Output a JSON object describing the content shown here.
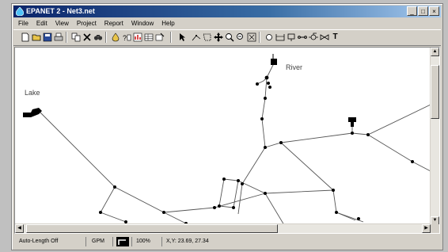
{
  "window": {
    "title": "EPANET 2 - Net3.net",
    "controls": {
      "minimize": "_",
      "maximize": "□",
      "close": "×"
    }
  },
  "menu": [
    "File",
    "Edit",
    "View",
    "Project",
    "Report",
    "Window",
    "Help"
  ],
  "toolbar": {
    "icons": [
      "new-file-icon",
      "open-file-icon",
      "save-icon",
      "print-icon",
      "copy-icon",
      "delete-icon",
      "find-icon",
      "run-icon",
      "query-icon",
      "graph-icon",
      "table-icon",
      "options-icon",
      "select-object-icon",
      "select-vertex-icon",
      "select-region-icon",
      "pan-icon",
      "zoom-in-icon",
      "zoom-out-icon",
      "full-extent-icon",
      "add-junction-icon",
      "add-reservoir-icon",
      "add-tank-icon",
      "add-pipe-icon",
      "add-pump-icon",
      "add-valve-icon",
      "add-label-icon"
    ],
    "text_tool_glyph": "T"
  },
  "map": {
    "labels": {
      "lake": "Lake",
      "river": "River"
    }
  },
  "status": {
    "auto_length": "Auto-Length Off",
    "flow_units": "GPM",
    "zoom": "100%",
    "coordinates": "X,Y: 23.69, 27.34"
  }
}
